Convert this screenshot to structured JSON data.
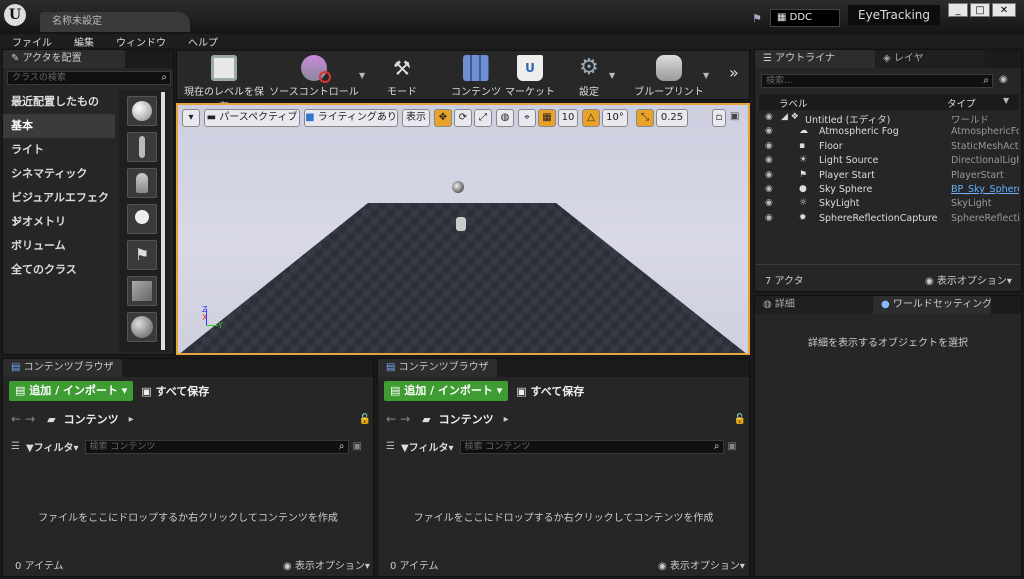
{
  "title_bar": {
    "document_tab": "名称未設定",
    "ddc_label": "DDC",
    "project_name": "EyeTracking",
    "window_controls": [
      "_",
      "□",
      "✕"
    ]
  },
  "menu": [
    "ファイル",
    "編集",
    "ウィンドウ",
    "ヘルプ"
  ],
  "place_actors": {
    "tab": "アクタを配置",
    "search_placeholder": "クラスの検索",
    "categories": [
      "最近配置したもの",
      "基本",
      "ライト",
      "シネマティック",
      "ビジュアルエフェクト",
      "ジオメトリ",
      "ボリューム",
      "全てのクラス"
    ],
    "selected_category": "基本"
  },
  "toolbar": {
    "buttons": [
      "現在のレベルを保存",
      "ソースコントロール",
      "モード",
      "コンテンツ",
      "マーケット",
      "設定",
      "ブループリント"
    ],
    "more": "»"
  },
  "viewport": {
    "perspective": "パースペクティブ",
    "lighting": "ライティングあり",
    "show": "表示",
    "grid_snap": "10",
    "rotation_snap": "10°",
    "scale_snap": "0.25"
  },
  "content_browser_left": {
    "tab": "コンテンツブラウザ",
    "add_import": "追加 / インポート",
    "save_all": "すべて保存",
    "path": "コンテンツ",
    "filter": "フィルタ",
    "search_placeholder": "検索 コンテンツ",
    "empty_message": "ファイルをここにドロップするか右クリックしてコンテンツを作成",
    "item_count": "0 アイテム",
    "view_options": "表示オプション"
  },
  "content_browser_right": {
    "tab": "コンテンツブラウザ",
    "add_import": "追加 / インポート",
    "save_all": "すべて保存",
    "path": "コンテンツ",
    "filter": "フィルタ",
    "search_placeholder": "検索 コンテンツ",
    "empty_message": "ファイルをここにドロップするか右クリックしてコンテンツを作成",
    "item_count": "0 アイテム",
    "view_options": "表示オプション"
  },
  "outliner": {
    "tab": "アウトライナ",
    "tab2": "レイヤ",
    "search_placeholder": "検索...",
    "col_label": "ラベル",
    "col_type": "タイプ",
    "rows": [
      {
        "label": "Untitled (エディタ)",
        "type": "ワールド"
      },
      {
        "label": "Atmospheric Fog",
        "type": "AtmosphericFog"
      },
      {
        "label": "Floor",
        "type": "StaticMeshActor"
      },
      {
        "label": "Light Source",
        "type": "DirectionalLight"
      },
      {
        "label": "Player Start",
        "type": "PlayerStart"
      },
      {
        "label": "Sky Sphere",
        "type": "BP_Sky_Sphere"
      },
      {
        "label": "SkyLight",
        "type": "SkyLight"
      },
      {
        "label": "SphereReflectionCapture",
        "type": "SphereReflectionCapture"
      }
    ],
    "actor_count": "7 アクタ",
    "view_options": "表示オプション"
  },
  "details": {
    "tab": "詳細",
    "tab2": "ワールドセッティング",
    "hint": "詳細を表示するオブジェクトを選択"
  }
}
